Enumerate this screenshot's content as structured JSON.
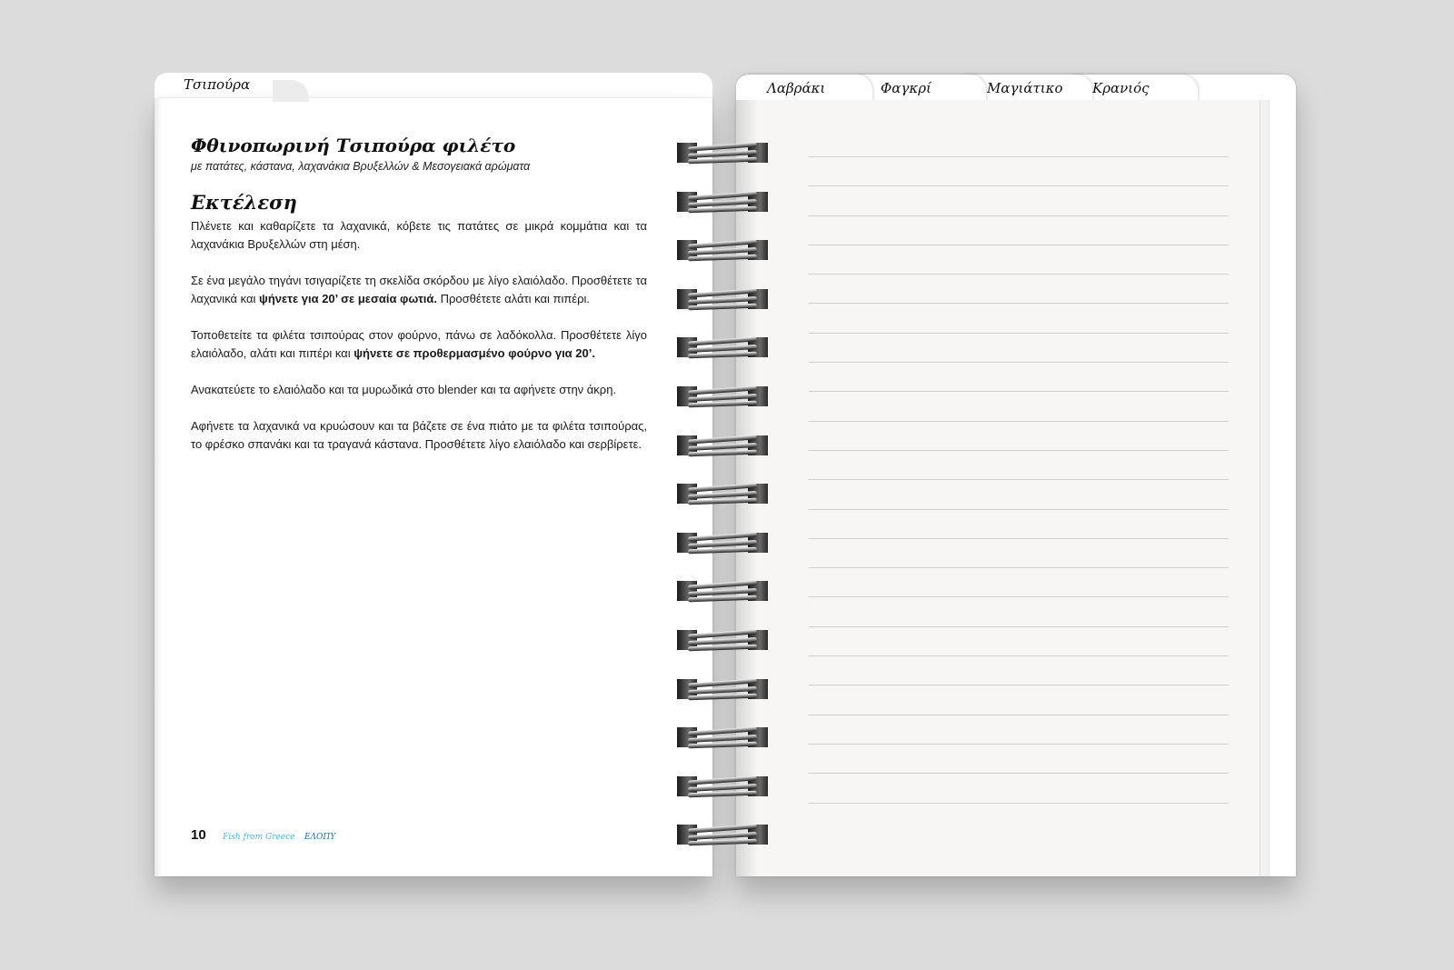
{
  "left_page": {
    "tab_label": "Τσιπούρα",
    "recipe_title": "Φθινοπωρινή Τσιπούρα φιλέτο",
    "recipe_subtitle": "με πατάτες, κάστανα, λαχανάκια Βρυξελλών & Μεσογειακά αρώματα",
    "section_title": "Εκτέλεση",
    "paragraphs": [
      {
        "text_a": "Πλένετε και καθαρίζετε τα λαχανικά, κόβετε τις πατάτες σε μικρά κομμάτια και τα λαχανάκια Βρυξελλών στη μέση.",
        "bold": "",
        "text_b": ""
      },
      {
        "text_a": "Σε ένα μεγάλο τηγάνι τσιγαρίζετε τη σκελίδα σκόρδου με λίγο ελαιόλαδο. Προσθέτετε τα λαχανικά και ",
        "bold": "ψήνετε για 20’ σε μεσαία φωτιά.",
        "text_b": " Προσθέτετε αλάτι και πιπέρι."
      },
      {
        "text_a": "Τοποθετείτε τα φιλέτα τσιπούρας στον φούρνο, πάνω σε λαδόκολλα. Προσθέτετε λίγο ελαιόλαδο, αλάτι και πιπέρι και ",
        "bold": "ψήνετε σε προθερμασμένο φούρνο για 20’.",
        "text_b": ""
      },
      {
        "text_a": "Ανακατεύετε το ελαιόλαδο και τα μυρωδικά στο blender και τα αφήνετε στην άκρη.",
        "bold": "",
        "text_b": ""
      },
      {
        "text_a": "Αφήνετε τα λαχανικά να κρυώσουν και τα βάζετε  σε ένα πιάτο με τα φιλέτα τσιπούρας, το φρέσκο σπανάκι και τα τραγανά κάστανα. Προσθέτετε λίγο ελαιόλαδο και σερβίρετε.",
        "bold": "",
        "text_b": ""
      }
    ],
    "page_number": "10",
    "brand_primary": "Fish from Greece",
    "brand_secondary": "ΕΛΟΠΥ"
  },
  "right_page": {
    "tabs": [
      "Λαβράκι",
      "Φαγκρί",
      "Μαγιάτικο",
      "Κρανιός"
    ]
  },
  "colors": {
    "background": "#dcdcdc",
    "page": "#ffffff",
    "notes_page": "#f7f6f4",
    "brand_light_blue": "#4fb5e0",
    "brand_dark_blue": "#1a6fae"
  }
}
